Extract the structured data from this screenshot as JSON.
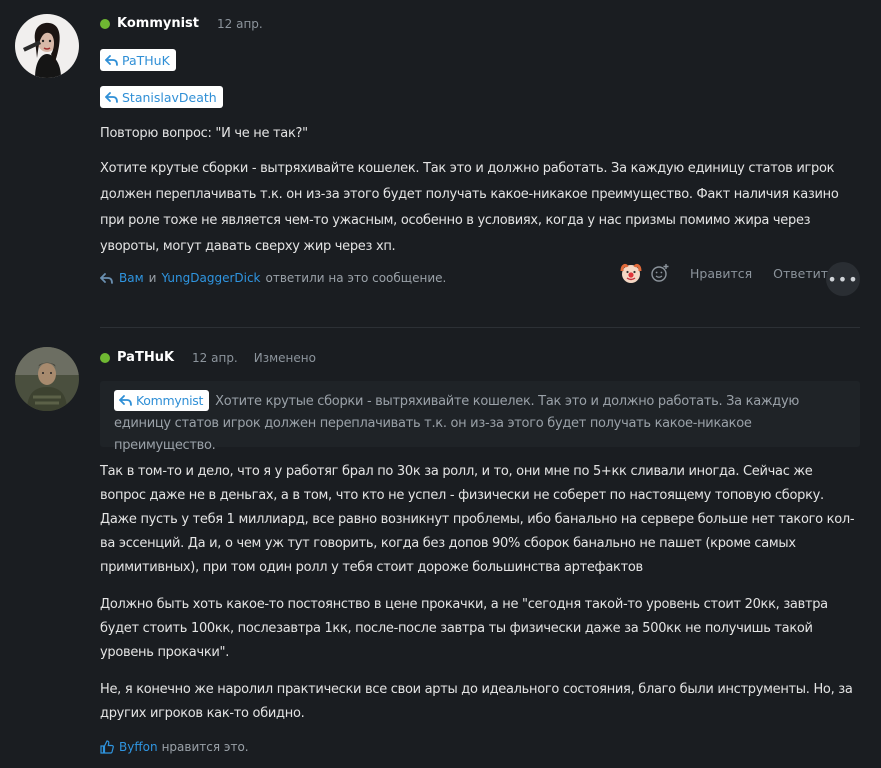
{
  "posts": [
    {
      "author": "Kommynist",
      "date": "12 апр.",
      "mentions": [
        "PaTHuK",
        "StanislavDeath"
      ],
      "paragraphs": [
        "Повторю вопрос: \"И че не так?\"",
        "Хотите крутые сборки - вытряхивайте кошелек. Так это и должно работать. За каждую единицу статов игрок должен переплачивать т.к. он из-за этого будет получать какое-никакое преимущество. Факт наличия казино при роле тоже не является чем-то ужасным, особенно в условиях, когда у нас призмы помимо жира через увороты, могут давать сверху жир через хп."
      ],
      "replied": {
        "you": "Вам",
        "and": "и",
        "user": "YungDaggerDick",
        "suffix": "ответили на это сообщение."
      },
      "actions": {
        "like": "Нравится",
        "reply": "Ответить",
        "more": "•••"
      },
      "icons": [
        "clown-reaction-icon",
        "add-reaction-icon"
      ]
    },
    {
      "author": "PaTHuK",
      "date": "12 апр.",
      "edited": "Изменено",
      "quote": {
        "author": "Kommynist",
        "text": "Хотите крутые сборки - вытряхивайте кошелек. Так это и должно работать. За каждую единицу статов игрок должен переплачивать т.к. он из-за этого будет получать какое-никакое преимущество."
      },
      "paragraphs": [
        "Так в том-то и дело, что я у работяг брал по 30к за ролл, и то, они мне по 5+кк сливали иногда. Сейчас же вопрос даже не в деньгах, а в том, что кто не успел - физически не соберет по настоящему топовую сборку. Даже пусть у тебя 1 миллиард, все равно возникнут проблемы, ибо банально на сервере больше нет такого кол-ва эссенций. Да и, о чем уж тут говорить, когда без допов 90% сборок банально не пашет (кроме самых примитивных), при том один ролл у тебя стоит дороже большинства артефактов",
        "Должно быть хоть какое-то постоянство в цене прокачки, а не \"сегодня такой-то уровень стоит 20кк, завтра будет стоить 100кк, послезавтра 1кк, после-после завтра ты физически даже за 500кк не получишь такой уровень прокачки\".",
        "Не, я конечно же наролил практически все свои арты до идеального состояния, благо были инструменты. Но, за других игроков как-то обидно."
      ],
      "likes": {
        "user": "Byffon",
        "suffix": "нравится это."
      }
    }
  ],
  "colors": {
    "background": "#1a1d21",
    "link": "#2f95e0",
    "online": "#6fb832"
  }
}
